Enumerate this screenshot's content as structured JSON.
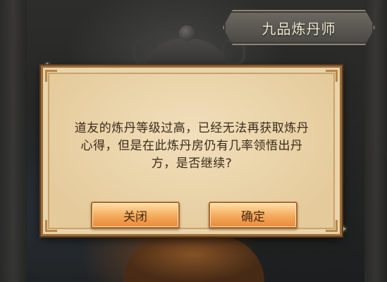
{
  "title": "九品炼丹师",
  "dialog": {
    "message": "道友的炼丹等级过高，已经无法再获取炼丹心得，但是在此炼丹房仍有几率领悟出丹方，是否继续?",
    "close_label": "关闭",
    "confirm_label": "确定"
  },
  "colors": {
    "dialog_bg": "#e9d4ab",
    "dialog_border": "#9b6e3a",
    "button_orange": "#f4a95a",
    "text_dark": "#3a2a1a"
  },
  "icons": [
    "sparkle-icon",
    "cauldron-icon"
  ]
}
